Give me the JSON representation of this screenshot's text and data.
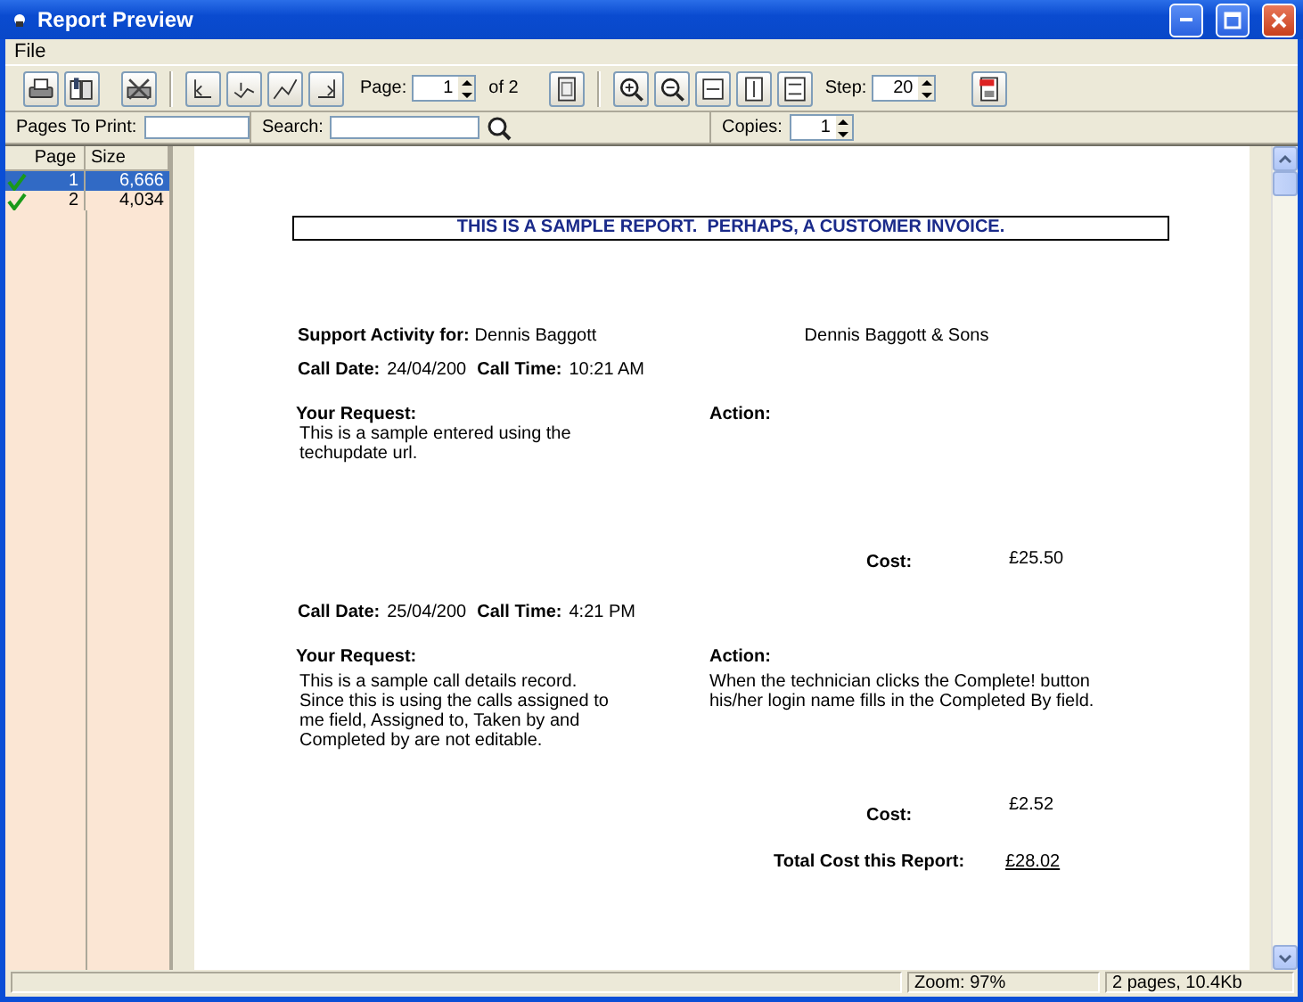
{
  "window": {
    "title": "Report Preview"
  },
  "menu": [
    {
      "label": "File"
    }
  ],
  "toolbar": {
    "page_label": "Page:",
    "page": "1",
    "page_of": "of 2",
    "step_label": "Step:",
    "step": "20"
  },
  "filter_bar": {
    "pages_label": "Pages To Print:",
    "search_label": "Search:",
    "copies_label": "Copies:",
    "copies": "1"
  },
  "pages_list": {
    "columns": [
      "Page",
      "Size"
    ],
    "rows": [
      {
        "page": "1",
        "size": "6,666",
        "checked": true,
        "selected": true
      },
      {
        "page": "2",
        "size": "4,034",
        "checked": true,
        "selected": false
      }
    ]
  },
  "report": {
    "heading": "THIS IS A SAMPLE REPORT.  PERHAPS, A CUSTOMER INVOICE.",
    "support_label": "Support Activity for:",
    "customer": "Dennis Baggott",
    "company": "Dennis Baggott & Sons",
    "calls": [
      {
        "date_label": "Call Date:",
        "date": "24/04/200",
        "time_label": "Call Time:",
        "time": "10:21 AM",
        "request_label": "Your Request:",
        "request": [
          "This is a sample entered using the",
          "techupdate url."
        ],
        "action_label": "Action:",
        "cost_label": "Cost:",
        "cost": "£25.50"
      },
      {
        "date_label": "Call Date:",
        "date": "25/04/200",
        "time_label": "Call Time:",
        "time": "4:21 PM",
        "request_label": "Your Request:",
        "request": [
          "This is a sample call details record.",
          "Since this is using the calls assigned to",
          "me field, Assigned to, Taken by and",
          "Completed by are not editable."
        ],
        "action_label": "Action:",
        "action": [
          "When the technician clicks the Complete! button",
          "his/her login name fills in the Completed By field."
        ],
        "cost_label": "Cost:",
        "cost": "£2.52"
      }
    ],
    "total_label": "Total Cost this Report:",
    "total": "£28.02"
  },
  "status_bar": {
    "zoom": "Zoom: 97%",
    "info": "2 pages, 10.4Kb"
  }
}
